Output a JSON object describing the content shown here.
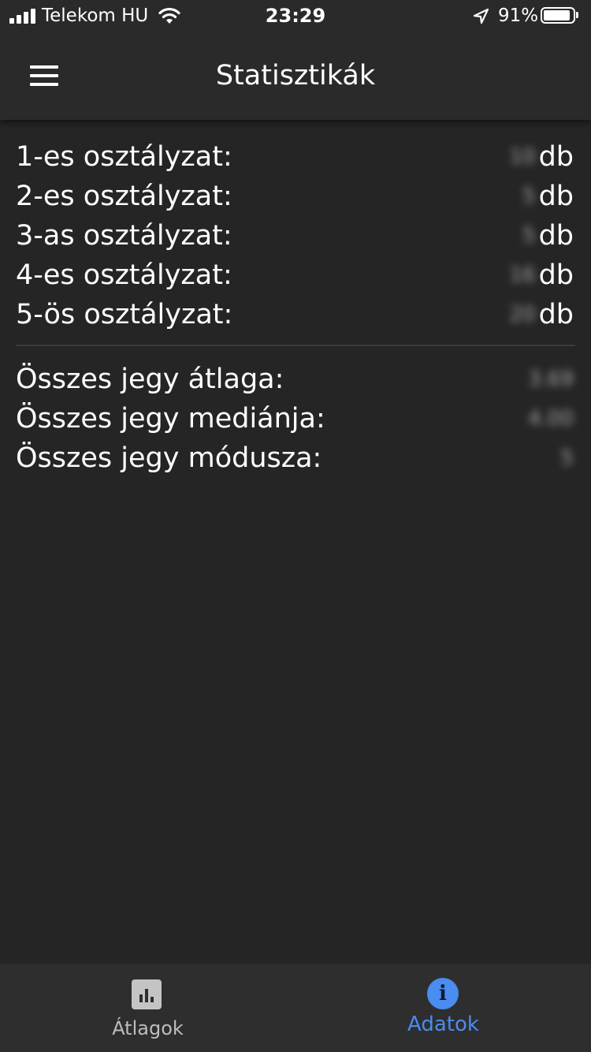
{
  "status_bar": {
    "carrier": "Telekom HU",
    "time": "23:29",
    "battery_percent_text": "91%",
    "battery_level": 0.91,
    "icons": [
      "signal-icon",
      "wifi-icon",
      "location-arrow-icon",
      "battery-icon"
    ]
  },
  "app_bar": {
    "title": "Statisztikák",
    "menu_icon": "hamburger-menu-icon"
  },
  "grades": [
    {
      "label": "1-es osztályzat:",
      "count": "10",
      "unit": "db"
    },
    {
      "label": "2-es osztályzat:",
      "count": "5",
      "unit": "db"
    },
    {
      "label": "3-as osztályzat:",
      "count": "5",
      "unit": "db"
    },
    {
      "label": "4-es osztályzat:",
      "count": "16",
      "unit": "db"
    },
    {
      "label": "5-ös osztályzat:",
      "count": "20",
      "unit": "db"
    }
  ],
  "summary": [
    {
      "label": "Összes jegy átlaga:",
      "value": "3.69"
    },
    {
      "label": "Összes jegy mediánja:",
      "value": "4.00"
    },
    {
      "label": "Összes jegy módusza:",
      "value": "5"
    }
  ],
  "bottom_nav": {
    "items": [
      {
        "label": "Átlagok",
        "icon": "bar-chart-icon",
        "active": false
      },
      {
        "label": "Adatok",
        "icon": "info-icon",
        "active": true
      }
    ],
    "active_color": "#4a8cf0",
    "inactive_color": "#bdbdbd"
  },
  "colors": {
    "background": "#252525",
    "app_bar": "#2a2a2a",
    "bottom_nav": "#2e2e2e",
    "text": "#ffffff"
  }
}
